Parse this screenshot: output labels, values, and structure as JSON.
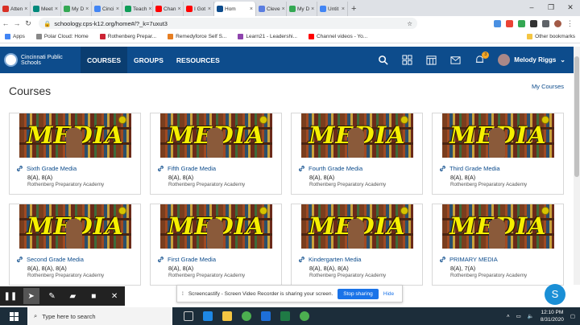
{
  "browser": {
    "tabs": [
      {
        "label": "Atten",
        "color": "#d93025"
      },
      {
        "label": "Meet",
        "color": "#00897b"
      },
      {
        "label": "My D",
        "color": "#34a853"
      },
      {
        "label": "Cinci",
        "color": "#4285f4"
      },
      {
        "label": "Teach",
        "color": "#0f9d58"
      },
      {
        "label": "Chan",
        "color": "#ff0000"
      },
      {
        "label": "I Got",
        "color": "#ff0000"
      },
      {
        "label": "Hom",
        "color": "#0d4c8c",
        "active": true
      },
      {
        "label": "Cleve",
        "color": "#5a7de0"
      },
      {
        "label": "My D",
        "color": "#34a853"
      },
      {
        "label": "Untit",
        "color": "#4285f4"
      }
    ],
    "url": "schoology.cps-k12.org/home#/?_k=7uxut3",
    "bookmarks": [
      {
        "label": "Apps",
        "color": "#4285f4"
      },
      {
        "label": "Polar Cloud: Home",
        "color": "#888"
      },
      {
        "label": "Rothenberg Prepar...",
        "color": "#c23"
      },
      {
        "label": "Remedyforce Self S...",
        "color": "#e67e22"
      },
      {
        "label": "Learn21 - Leadershi...",
        "color": "#8e44ad"
      },
      {
        "label": "Channel videos - Yo...",
        "color": "#ff0000"
      }
    ],
    "other_bookmarks": "Other bookmarks"
  },
  "header": {
    "logo_text": "Cincinnati Public Schools",
    "nav": [
      "COURSES",
      "GROUPS",
      "RESOURCES"
    ],
    "notification_count": "3",
    "user_name": "Melody Riggs"
  },
  "page": {
    "title": "Courses",
    "my_courses_link": "My Courses"
  },
  "courses": [
    {
      "image_text": "MEDIA",
      "title": "Sixth Grade Media",
      "sections": "8(A), 8(A)",
      "school": "Rothenberg Preparatory Academy"
    },
    {
      "image_text": "MEDIA",
      "title": "Fifth Grade Media",
      "sections": "8(A), 8(A)",
      "school": "Rothenberg Preparatory Academy"
    },
    {
      "image_text": "MEDIA",
      "title": "Fourth Grade Media",
      "sections": "8(A), 8(A)",
      "school": "Rothenberg Preparatory Academy"
    },
    {
      "image_text": "MEDIA",
      "title": "Third Grade Media",
      "sections": "8(A), 8(A)",
      "school": "Rothenberg Preparatory Academy"
    },
    {
      "image_text": "MEDIA",
      "title": "Second Grade Media",
      "sections": "8(A), 8(A), 8(A)",
      "school": "Rothenberg Preparatory Academy"
    },
    {
      "image_text": "MEDIA",
      "title": "First Grade Media",
      "sections": "8(A), 8(A)",
      "school": "Rothenberg Preparatory Academy"
    },
    {
      "image_text": "MEDIA",
      "title": "Kindergarten Media",
      "sections": "8(A), 8(A), 8(A)",
      "school": "Rothenberg Preparatory Academy"
    },
    {
      "image_text": "MEDIA",
      "title": "PRIMARY MEDIA",
      "sections": "8(A), 7(A)",
      "school": "Rothenberg Preparatory Academy"
    }
  ],
  "screencastify": {
    "message": "Screencastify - Screen Video Recorder is sharing your screen.",
    "stop_label": "Stop sharing",
    "hide_label": "Hide"
  },
  "fab_label": "S",
  "taskbar": {
    "search_placeholder": "Type here to search",
    "time": "12:10 PM",
    "date": "8/31/2020"
  }
}
